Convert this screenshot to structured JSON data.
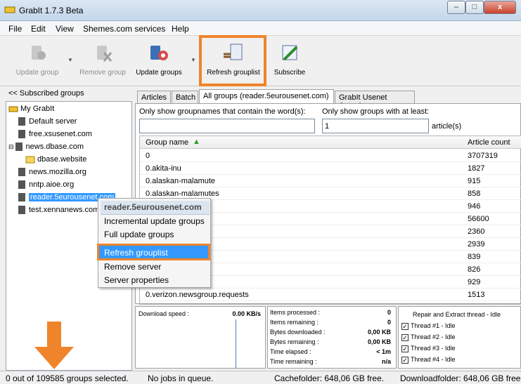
{
  "window": {
    "title": "GrabIt 1.7.3 Beta",
    "min": "–",
    "max": "□",
    "close": "x"
  },
  "menu": [
    "File",
    "Edit",
    "View",
    "Shemes.com services",
    "Help"
  ],
  "toolbar": {
    "update_group": "Update group",
    "remove_group": "Remove group",
    "update_groups": "Update groups",
    "refresh_grouplist": "Refresh grouplist",
    "subscribe": "Subscribe"
  },
  "left": {
    "header": "<< Subscribed groups",
    "tree": [
      "My GrabIt",
      "Default server",
      "free.xsusenet.com",
      "news.dbase.com",
      "dbase.website",
      "news.mozilla.org",
      "nntp.aioe.org",
      "reader.5eurousenet.com",
      "test.xennanews.com"
    ]
  },
  "tabs": [
    "Articles",
    "Batch",
    "All groups (reader.5eurousenet.com)",
    "GrabIt Usenet Search"
  ],
  "filters": {
    "name_label": "Only show groupnames that contain the word(s):",
    "name_value": "",
    "count_label": "Only show groups with at least:",
    "count_value": "1",
    "count_suffix": "article(s)"
  },
  "grid": {
    "col_name": "Group name",
    "col_count": "Article count",
    "rows": [
      [
        "0",
        "3707319"
      ],
      [
        "0.akita-inu",
        "1827"
      ],
      [
        "0.alaskan-malamute",
        "915"
      ],
      [
        "0.alaskan-malamutes",
        "858"
      ],
      [
        "",
        "946"
      ],
      [
        "",
        "56600"
      ],
      [
        "",
        "2360"
      ],
      [
        "-general",
        "2939"
      ],
      [
        "m",
        "839"
      ],
      [
        "",
        "826"
      ],
      [
        "",
        "929"
      ],
      [
        "0.verizon.newsgroup.requests",
        "1513"
      ]
    ]
  },
  "context_menu": {
    "header": "reader.5eurousenet.com",
    "items": [
      "Incremental update groups",
      "Full update groups",
      "Refresh grouplist",
      "Remove server",
      "Server properties"
    ]
  },
  "download": {
    "label": "Download speed :",
    "value": "0.00 KB/s"
  },
  "stats": [
    [
      "Items processed :",
      "0"
    ],
    [
      "Items remaining :",
      "0"
    ],
    [
      "Bytes downloaded :",
      "0,00 KB"
    ],
    [
      "Bytes remaining :",
      "0,00 KB"
    ],
    [
      "Time elapsed :",
      "< 1m"
    ],
    [
      "Time remaining :",
      "n/a"
    ]
  ],
  "threads": {
    "title": "Repair and Extract thread - Idle",
    "items": [
      "Thread #1 - Idle",
      "Thread #2 - Idle",
      "Thread #3 - Idle",
      "Thread #4 - Idle"
    ]
  },
  "status": {
    "selection": "0 out of 109585 groups selected.",
    "jobs": "No jobs in queue.",
    "cache": "Cachefolder: 648,06 GB free.",
    "download": "Downloadfolder: 648,06 GB free."
  },
  "colors": {
    "highlight_orange": "#f0842a",
    "selection_blue": "#3399ff"
  }
}
